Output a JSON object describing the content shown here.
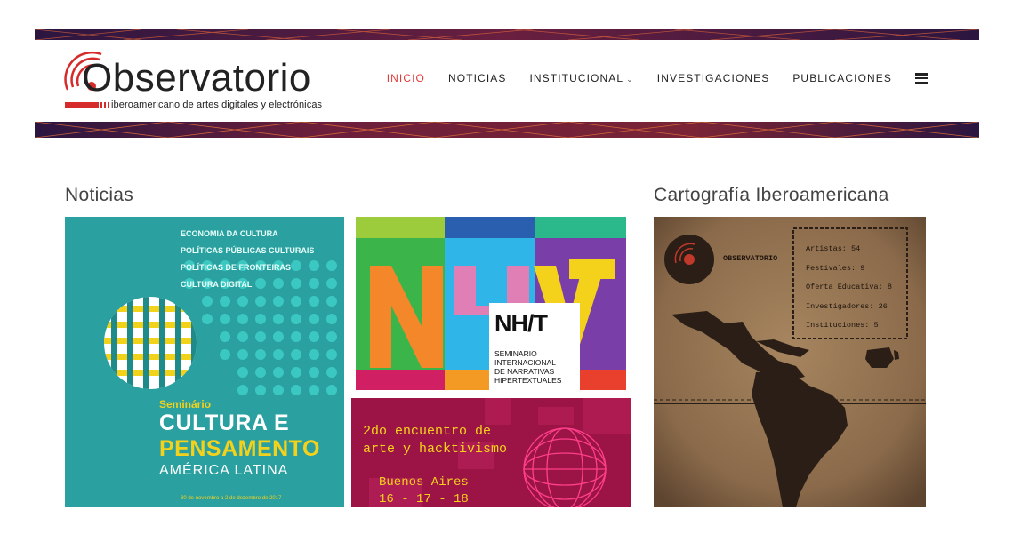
{
  "logo": {
    "wordmark": "Observatorio",
    "subtitle": "iberoamericano de artes digitales y electrónicas"
  },
  "nav": {
    "items": [
      {
        "label": "INICIO",
        "active": true
      },
      {
        "label": "NOTICIAS",
        "active": false
      },
      {
        "label": "INSTITUCIONAL",
        "active": false,
        "dropdown": true
      },
      {
        "label": "INVESTIGACIONES",
        "active": false
      },
      {
        "label": "PUBLICACIONES",
        "active": false
      }
    ],
    "menu_icon": "hamburger-icon"
  },
  "noticias": {
    "heading": "Noticias",
    "seminario": {
      "topics": [
        "ECONOMIA DA CULTURA",
        "POLÍTICAS PÚBLICAS CULTURAIS",
        "POLÍTICAS DE FRONTEIRAS",
        "CULTURA DIGITAL"
      ],
      "label": "Seminário",
      "title_line1": "CULTURA E",
      "title_line2": "PENSAMENTO",
      "title_line3": "AMÉRICA LATINA",
      "dates": "30 de novembro a 2 de dezembro de 2017"
    },
    "nhnt": {
      "logo_text": "NH/T",
      "caption": [
        "SEMINARIO",
        "INTERNACIONAL",
        "DE NARRATIVAS",
        "HIPERTEXTUALES"
      ]
    },
    "hacktivismo": {
      "line1": "2do encuentro de",
      "line2": "arte y hacktivismo",
      "city": "Buenos Aires",
      "dates": "16 - 17 - 18"
    }
  },
  "cartografia": {
    "heading": "Cartografía Iberoamericana",
    "brand": "OBSERVATORIO",
    "stats": [
      "Artistas: 54",
      "Festivales: 9",
      "Oferta Educativa: 8",
      "Investigadores: 26",
      "Instituciones: 5"
    ]
  },
  "colors": {
    "accent": "#e03a3a",
    "teal": "#2aa3a3",
    "yellow": "#f4d21c",
    "magenta": "#a81a55",
    "map_bg": "#8a6a4a"
  }
}
